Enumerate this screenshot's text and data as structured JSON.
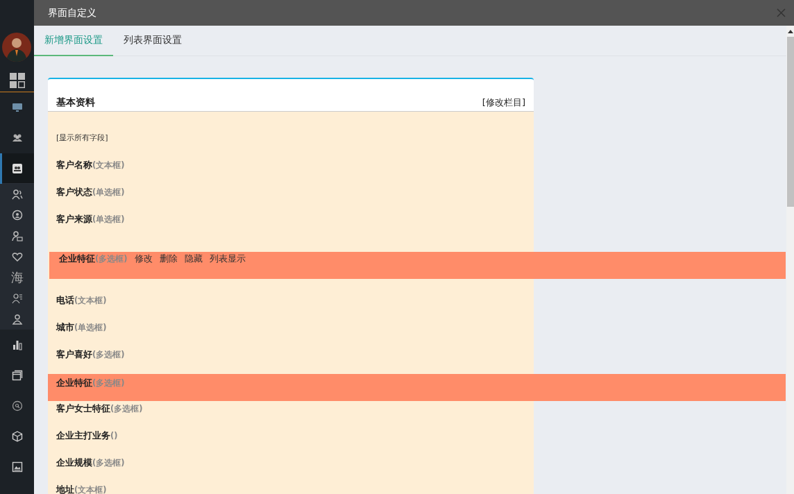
{
  "window": {
    "title": "界面自定义"
  },
  "sidebar": {
    "items": [
      {
        "selected": false
      },
      {
        "selected": false
      },
      {
        "selected": true,
        "expanded": true,
        "children": [
          {
            "selected": false
          },
          {
            "selected": false
          },
          {
            "selected": false
          },
          {
            "selected": false
          },
          {
            "label": "海",
            "selected": false
          },
          {
            "selected": false
          },
          {
            "selected": false
          }
        ]
      },
      {
        "selected": false
      },
      {
        "selected": false
      },
      {
        "selected": false
      },
      {
        "selected": false
      },
      {
        "selected": false
      }
    ]
  },
  "tabs": [
    {
      "label": "新增界面设置",
      "selected": true
    },
    {
      "label": "列表界面设置",
      "selected": false
    }
  ],
  "section": {
    "title": "基本资料",
    "edit_link": "[修改栏目]",
    "show_all_link": "[显示所有字段]",
    "fields": [
      {
        "name": "客户名称",
        "type": "(文本框)",
        "kind": "field"
      },
      {
        "name": "客户状态",
        "type": "(单选框)",
        "kind": "field"
      },
      {
        "name": "客户来源",
        "type": "(单选框)",
        "kind": "field"
      },
      {
        "name": "企业特征",
        "type": "(多选框)",
        "kind": "dragging",
        "actions": [
          "修改",
          "删除",
          "隐藏",
          "列表显示"
        ]
      },
      {
        "name": "电话",
        "type": "(文本框)",
        "kind": "field"
      },
      {
        "name": "城市",
        "type": "(单选框)",
        "kind": "field"
      },
      {
        "name": "客户喜好",
        "type": "(多选框)",
        "kind": "field"
      },
      {
        "name": "企业特征",
        "type": "(多选框)",
        "kind": "placeholder"
      },
      {
        "name": "客户女士特征",
        "type": "(多选框)",
        "kind": "field"
      },
      {
        "name": "企业主打业务",
        "type": "()",
        "kind": "field"
      },
      {
        "name": "企业规模",
        "type": "(多选框)",
        "kind": "field"
      },
      {
        "name": "地址",
        "type": "(文本框)",
        "kind": "field"
      }
    ]
  }
}
